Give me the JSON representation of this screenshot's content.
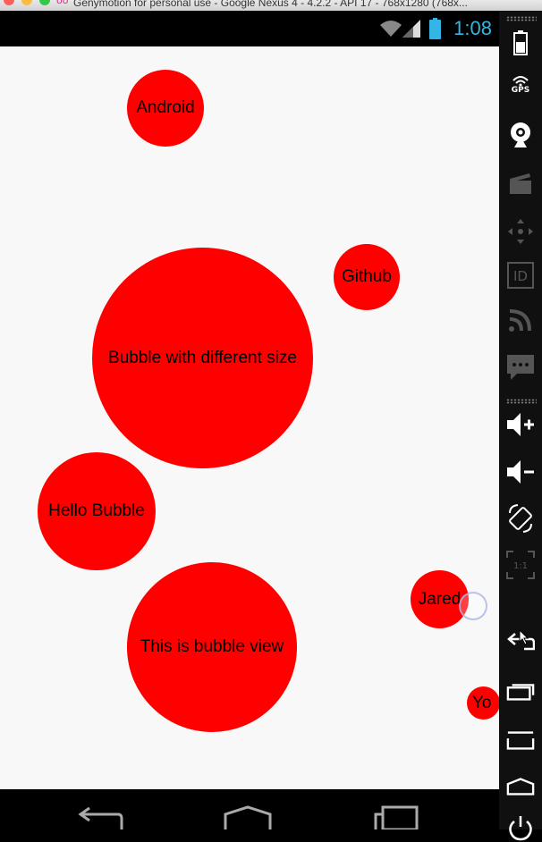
{
  "window": {
    "title": "Genymotion for personal use - Google Nexus 4 - 4.2.2 - API 17 - 768x1280 (768x..."
  },
  "status_bar": {
    "time": "1:08",
    "clock_color": "#33b5e5",
    "icons": [
      "wifi-icon",
      "signal-icon",
      "battery-icon"
    ]
  },
  "bubbles": [
    {
      "label": "Android"
    },
    {
      "label": "Github"
    },
    {
      "label": "Bubble with different size"
    },
    {
      "label": "Hello Bubble"
    },
    {
      "label": "Jared"
    },
    {
      "label": "This is bubble view"
    },
    {
      "label": "Yo"
    }
  ],
  "colors": {
    "bubble": "#ff0000",
    "background": "#f8f8f8",
    "status_bar": "#000000"
  },
  "nav_bar": {
    "buttons": [
      "back-icon",
      "home-icon",
      "recents-icon"
    ]
  },
  "sidebar": {
    "gps_label": "GPS",
    "id_label": "ID",
    "scale_label": "1:1",
    "buttons": [
      "battery",
      "gps",
      "webcam",
      "screencast",
      "remote-control",
      "device-id",
      "network",
      "sms",
      "volume-up",
      "volume-down",
      "rotate",
      "scale",
      "back",
      "recents",
      "menu",
      "home",
      "power"
    ]
  }
}
